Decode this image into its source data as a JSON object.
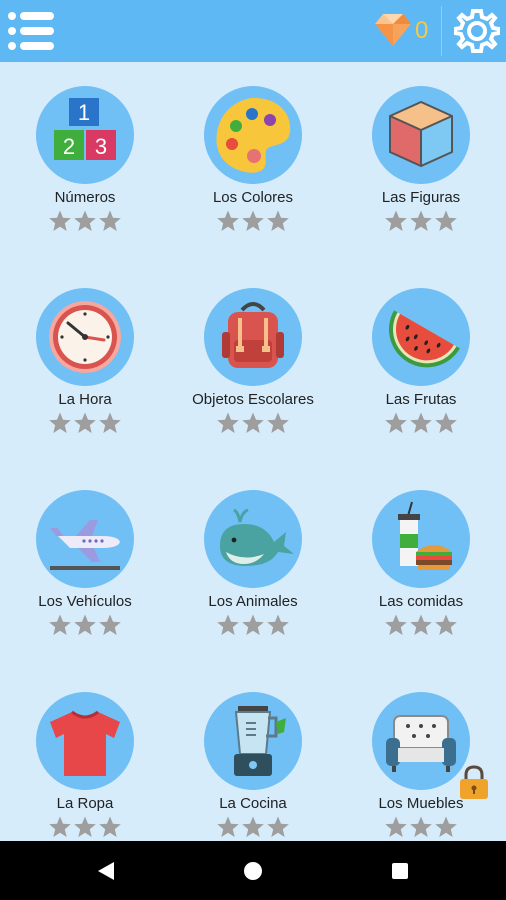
{
  "app_bar": {
    "menu_icon": "hamburger-menu-icon",
    "gem_icon": "diamond-icon",
    "gem_count": "0",
    "settings_icon": "gear-icon",
    "colors": {
      "bar": "#5db8f4",
      "gem_count": "#f2c94c"
    }
  },
  "categories": [
    {
      "label": "Números",
      "icon": "number-blocks-icon",
      "stars": 0,
      "locked": false
    },
    {
      "label": "Los Colores",
      "icon": "paint-palette-icon",
      "stars": 0,
      "locked": false
    },
    {
      "label": "Las Figuras",
      "icon": "cube-icon",
      "stars": 0,
      "locked": false
    },
    {
      "label": "La Hora",
      "icon": "clock-icon",
      "stars": 0,
      "locked": false
    },
    {
      "label": "Objetos Escolares",
      "icon": "backpack-icon",
      "stars": 0,
      "locked": false
    },
    {
      "label": "Las Frutas",
      "icon": "watermelon-icon",
      "stars": 0,
      "locked": false
    },
    {
      "label": "Los Vehículos",
      "icon": "airplane-icon",
      "stars": 0,
      "locked": false
    },
    {
      "label": "Los Animales",
      "icon": "whale-icon",
      "stars": 0,
      "locked": false
    },
    {
      "label": "Las comidas",
      "icon": "fast-food-icon",
      "stars": 0,
      "locked": false
    },
    {
      "label": "La Ropa",
      "icon": "t-shirt-icon",
      "stars": 0,
      "locked": false
    },
    {
      "label": "La Cocina",
      "icon": "blender-icon",
      "stars": 0,
      "locked": false
    },
    {
      "label": "Los Muebles",
      "icon": "sofa-icon",
      "stars": 0,
      "locked": true
    }
  ],
  "max_stars": 3,
  "system_nav": {
    "back_icon": "back-triangle-icon",
    "home_icon": "home-circle-icon",
    "recents_icon": "recents-square-icon"
  }
}
